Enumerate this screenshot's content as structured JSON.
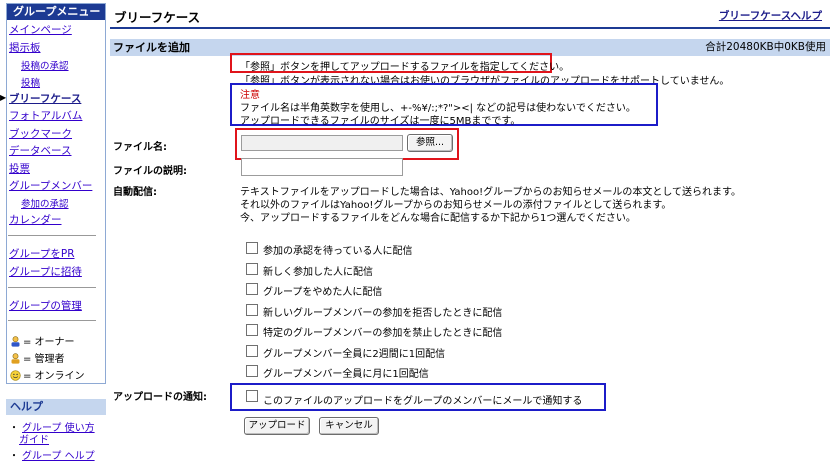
{
  "sidebar": {
    "menu_title": "グループメニュー",
    "items": [
      {
        "label": "メインページ"
      },
      {
        "label": "掲示板"
      },
      {
        "label": "投稿の承認"
      },
      {
        "label": "投稿"
      },
      {
        "label": "ブリーフケース"
      },
      {
        "label": "フォトアルバム"
      },
      {
        "label": "ブックマーク"
      },
      {
        "label": "データベース"
      },
      {
        "label": "投票"
      },
      {
        "label": "グループメンバー"
      },
      {
        "label": "参加の承認"
      },
      {
        "label": "カレンダー"
      },
      {
        "label": "グループをPR"
      },
      {
        "label": "グループに招待"
      },
      {
        "label": "グループの管理"
      }
    ],
    "legend": [
      {
        "label": "= オーナー",
        "icon": "owner-icon"
      },
      {
        "label": "= 管理者",
        "icon": "admin-icon"
      },
      {
        "label": "= オンライン",
        "icon": "online-icon"
      }
    ],
    "help_title": "ヘルプ",
    "help_items": [
      {
        "line1": "グループ 使い方",
        "line2": "ガイド"
      },
      {
        "line1": "グループ ヘルプ"
      }
    ]
  },
  "header": {
    "title": "ブリーフケース",
    "help_link": "ブリーフケースヘルプ"
  },
  "section": {
    "title": "ファイルを追加",
    "usage": "合計20480KB中0KB使用"
  },
  "instructions": {
    "line1": "「参照」ボタンを押してアップロードするファイルを指定してください。",
    "line2": "「参照」ボタンが表示されない場合はお使いのブラウザがファイルのアップロードをサポートしていません。",
    "notice_title": "注意",
    "notice1": "ファイル名は半角英数字を使用し、+-%¥/:;*?\"><| などの記号は使わないでください。",
    "notice2": "アップロードできるファイルのサイズは一度に5MBまでです。"
  },
  "form": {
    "file_name_label": "ファイル名:",
    "browse_button": "参照...",
    "file_desc_label": "ファイルの説明:",
    "auto_delivery_label": "自動配信:",
    "auto_text1": "テキストファイルをアップロードした場合は、Yahoo!グループからのお知らせメールの本文として送られます。",
    "auto_text2": "それ以外のファイルはYahoo!グループからのお知らせメールの添付ファイルとして送られます。",
    "auto_text3": "今、アップロードするファイルをどんな場合に配信するか下記から1つ選んでください。",
    "options": [
      {
        "label": "参加の承認を待っている人に配信"
      },
      {
        "label": "新しく参加した人に配信"
      },
      {
        "label": "グループをやめた人に配信"
      },
      {
        "label": "新しいグループメンバーの参加を拒否したときに配信"
      },
      {
        "label": "特定のグループメンバーの参加を禁止したときに配信"
      },
      {
        "label": "グループメンバー全員に2週間に1回配信"
      },
      {
        "label": "グループメンバー全員に月に1回配信"
      }
    ],
    "notify_label": "アップロードの通知:",
    "notify_option": "このファイルのアップロードをグループのメンバーにメールで通知する",
    "upload_button": "アップロード",
    "cancel_button": "キャンセル"
  },
  "colors": {
    "menu_header_bg": "#1c3a93",
    "section_bar_bg": "#c5d6ee",
    "link": "#3300cc",
    "highlight_red": "#e0141b",
    "highlight_blue": "#1c1cc8",
    "notice_red": "#cc0000"
  }
}
